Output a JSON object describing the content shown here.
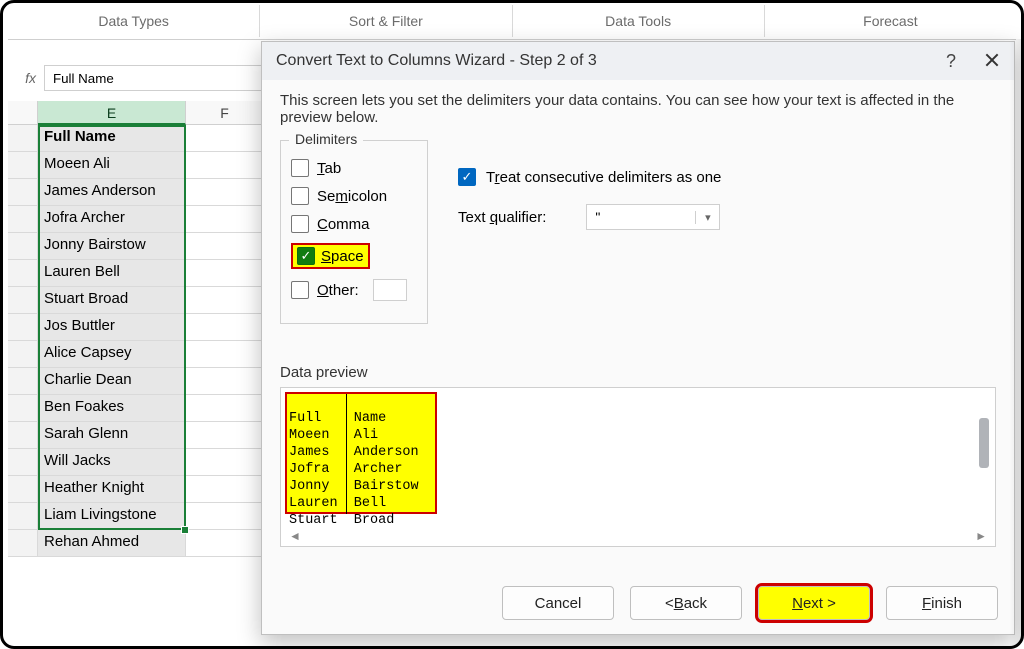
{
  "ribbon": {
    "groups": [
      "Data Types",
      "Sort & Filter",
      "Data Tools",
      "Forecast"
    ]
  },
  "formula": {
    "fx": "fx",
    "value": "Full Name"
  },
  "grid": {
    "cols": {
      "E": "E",
      "F": "F"
    },
    "header": "Full Name",
    "rows": [
      "Moeen Ali",
      "James Anderson",
      "Jofra Archer",
      "Jonny Bairstow",
      "Lauren Bell",
      "Stuart Broad",
      "Jos Buttler",
      "Alice Capsey",
      "Charlie Dean",
      "Ben Foakes",
      "Sarah Glenn",
      "Will Jacks",
      "Heather Knight",
      "Liam Livingstone",
      "Rehan Ahmed"
    ]
  },
  "dialog": {
    "title": "Convert Text to Columns Wizard - Step 2 of 3",
    "help": "?",
    "desc": "This screen lets you set the delimiters your data contains.  You can see how your text is affected in the preview below.",
    "delimiters_label": "Delimiters",
    "tab": "ab",
    "tab_u": "T",
    "semicolon": "Se",
    "semicolon_u": "m",
    "semicolon_rest": "icolon",
    "comma": "omma",
    "comma_u": "C",
    "space": "pace",
    "space_u": "S",
    "other": "ther:",
    "other_u": "O",
    "treat": "T",
    "treat_u": "r",
    "treat_rest": "eat consecutive delimiters as one",
    "text_qualifier_label": "Text ",
    "text_qualifier_u": "q",
    "text_qualifier_rest": "ualifier:",
    "text_qualifier_value": "\"",
    "preview_label": "Data preview",
    "preview_rows": [
      {
        "a": "Full",
        "b": "Name"
      },
      {
        "a": "Moeen",
        "b": "Ali"
      },
      {
        "a": "James",
        "b": "Anderson"
      },
      {
        "a": "Jofra",
        "b": "Archer"
      },
      {
        "a": "Jonny",
        "b": "Bairstow"
      },
      {
        "a": "Lauren",
        "b": "Bell"
      },
      {
        "a": "Stuart",
        "b": "Broad"
      }
    ],
    "btn_cancel": "Cancel",
    "btn_back_pre": "< ",
    "btn_back_u": "B",
    "btn_back_rest": "ack",
    "btn_next_u": "N",
    "btn_next_rest": "ext >",
    "btn_finish_u": "F",
    "btn_finish_rest": "inish"
  }
}
